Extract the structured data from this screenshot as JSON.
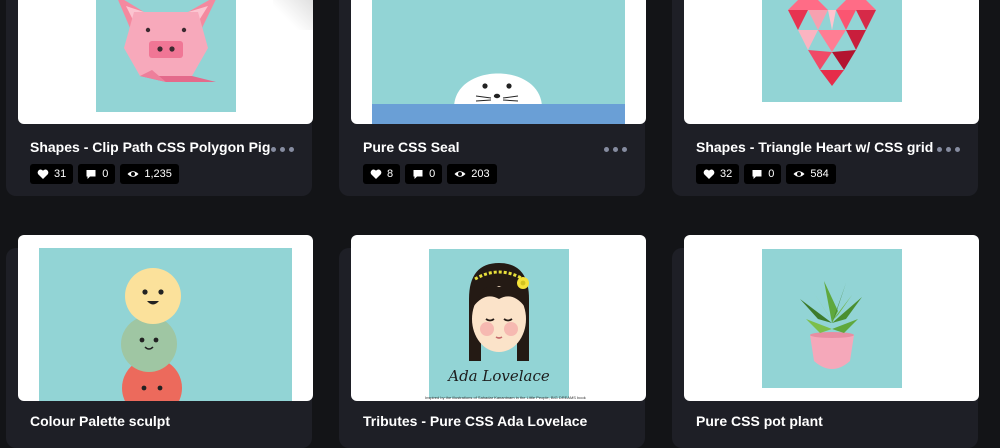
{
  "colors": {
    "page_bg": "#131417",
    "card_bg": "#1e1f26",
    "art_teal": "#92d4d5",
    "stat_bg": "#000000"
  },
  "cards": [
    {
      "title": "Shapes - Clip Path CSS Polygon Pig",
      "likes": "31",
      "comments": "0",
      "views": "1,235",
      "art": "pig"
    },
    {
      "title": "Pure CSS Seal",
      "likes": "8",
      "comments": "0",
      "views": "203",
      "art": "seal"
    },
    {
      "title": "Shapes - Triangle Heart w/ CSS grid",
      "likes": "32",
      "comments": "0",
      "views": "584",
      "art": "heart"
    },
    {
      "title": "Colour Palette sculpt",
      "art": "ice-cream"
    },
    {
      "title": "Tributes - Pure CSS Ada Lovelace",
      "art": "ada-lovelace",
      "art_text": "Ada Lovelace",
      "caption": "Inspired by the illustrations of Sahadar Kanantnam in the Little People, BIG DREAMS book"
    },
    {
      "title": "Pure CSS pot plant",
      "art": "pot-plant"
    }
  ],
  "icons": {
    "like": "heart-icon",
    "comment": "comment-icon",
    "view": "eye-icon",
    "menu": "more-dots-icon"
  }
}
